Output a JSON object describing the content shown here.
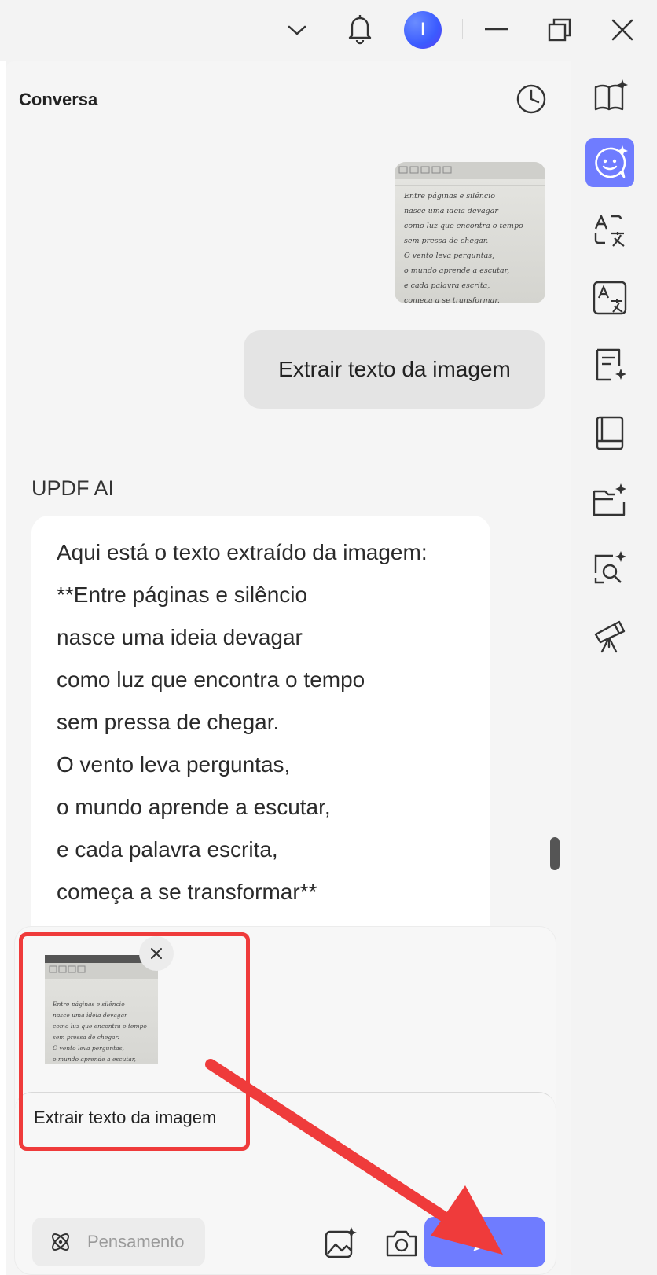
{
  "titlebar": {
    "avatar_initial": "I",
    "icons": [
      "chevron-down-icon",
      "bell-icon",
      "minimize-icon",
      "restore-icon",
      "close-icon"
    ]
  },
  "panel": {
    "title": "Conversa",
    "history_icon": "clock-icon"
  },
  "conversation": {
    "user_message": "Extrair texto da imagem",
    "ai_name": "UPDF AI",
    "ai_lines": [
      "Aqui está o texto extraído da imagem:",
      "**Entre páginas e silêncio",
      "nasce uma ideia devagar",
      "como luz que encontra o tempo",
      "sem pressa de chegar.",
      "O vento leva perguntas,",
      "o mundo aprende a escutar,",
      "e cada palavra escrita,",
      "começa a se transformar**"
    ]
  },
  "handwritten_image": {
    "lines": [
      "Entre páginas e silêncio",
      "nasce uma ideia devagar",
      "como luz que encontra o tempo",
      "sem pressa de chegar.",
      "O vento leva perguntas,",
      "o mundo aprende a escutar,",
      "e cada palavra escrita,",
      "começa a se transformar."
    ]
  },
  "composer": {
    "input_text": "Extrair texto da imagem",
    "thinking_label": "Pensamento",
    "icons": [
      "atom-icon",
      "image-ai-icon",
      "camera-icon",
      "send-icon",
      "remove-attachment-icon"
    ]
  },
  "rightbar": {
    "items": [
      "book-sparkle-icon",
      "chat-bot-icon",
      "translate-icon",
      "translate-box-icon",
      "summarize-icon",
      "notebook-icon",
      "folder-sparkle-icon",
      "search-sparkle-icon",
      "telescope-icon"
    ],
    "active": "chat-bot-icon"
  },
  "colors": {
    "accent": "#6f7cff",
    "annotation": "#ef3b3b"
  }
}
